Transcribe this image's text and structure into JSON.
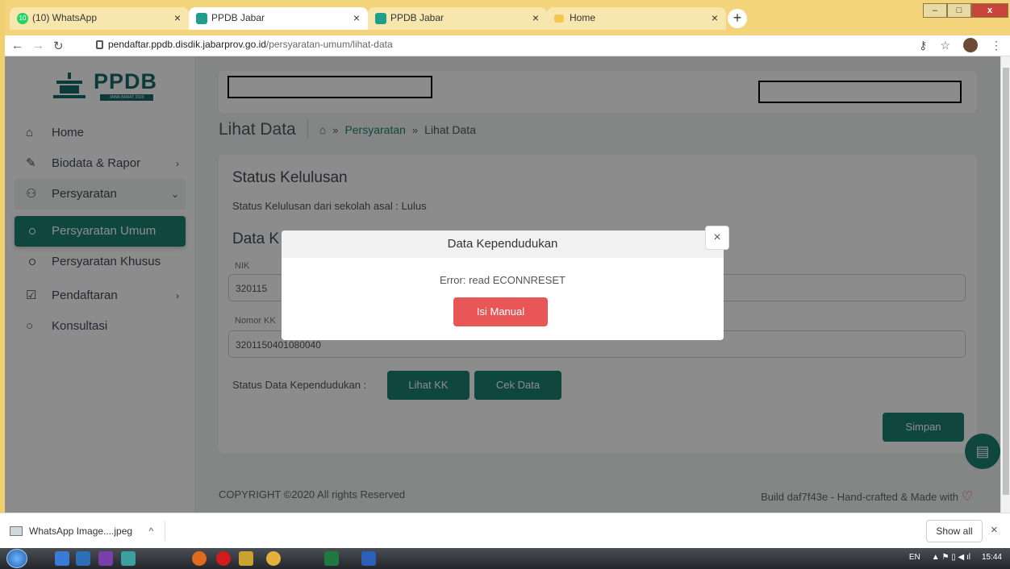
{
  "browser": {
    "tabs": [
      {
        "title": "(10) WhatsApp",
        "badge": "10"
      },
      {
        "title": "PPDB Jabar"
      },
      {
        "title": "PPDB Jabar"
      },
      {
        "title": "Home"
      }
    ],
    "new_tab": "+",
    "window_buttons": {
      "min": "–",
      "max": "□",
      "close": "x"
    },
    "url_host": "pendaftar.ppdb.disdik.jabarprov.go.id",
    "url_path": "/persyaratan-umum/lihat-data"
  },
  "sidebar": {
    "logo_text": "PPDB",
    "logo_sub": "JAWA BARAT 2020",
    "items": [
      {
        "label": "Home"
      },
      {
        "label": "Biodata & Rapor"
      },
      {
        "label": "Persyaratan"
      },
      {
        "label": "Persyaratan Umum"
      },
      {
        "label": "Persyaratan Khusus"
      },
      {
        "label": "Pendaftaran"
      },
      {
        "label": "Konsultasi"
      }
    ]
  },
  "breadcrumb": {
    "page_title": "Lihat Data",
    "sep": "»",
    "link": "Persyaratan",
    "current": "Lihat Data"
  },
  "card": {
    "status_title": "Status Kelulusan",
    "status_text": "Status Kelulusan dari sekolah asal : Lulus",
    "data_title": "Data K",
    "nik_label": "NIK",
    "nik_value": "320115",
    "kk_label": "Nomor KK",
    "kk_value": "3201150401080040",
    "status_data_label": "Status Data Kependudukan :",
    "btn_lihat_kk": "Lihat KK",
    "btn_cek_data": "Cek Data",
    "btn_simpan": "Simpan"
  },
  "footer": {
    "copyright": "COPYRIGHT ©2020 All rights Reserved",
    "build": "Build daf7f43e - Hand-crafted & Made with"
  },
  "modal": {
    "title": "Data Kependudukan",
    "error": "Error: read ECONNRESET",
    "button": "Isi Manual",
    "close": "×"
  },
  "downloads": {
    "file": "WhatsApp Image....jpeg",
    "show_all": "Show all",
    "close": "×"
  },
  "taskbar": {
    "lang": "EN",
    "time": "15:44"
  },
  "colors": {
    "primary": "#1c8272",
    "danger": "#e85656"
  }
}
